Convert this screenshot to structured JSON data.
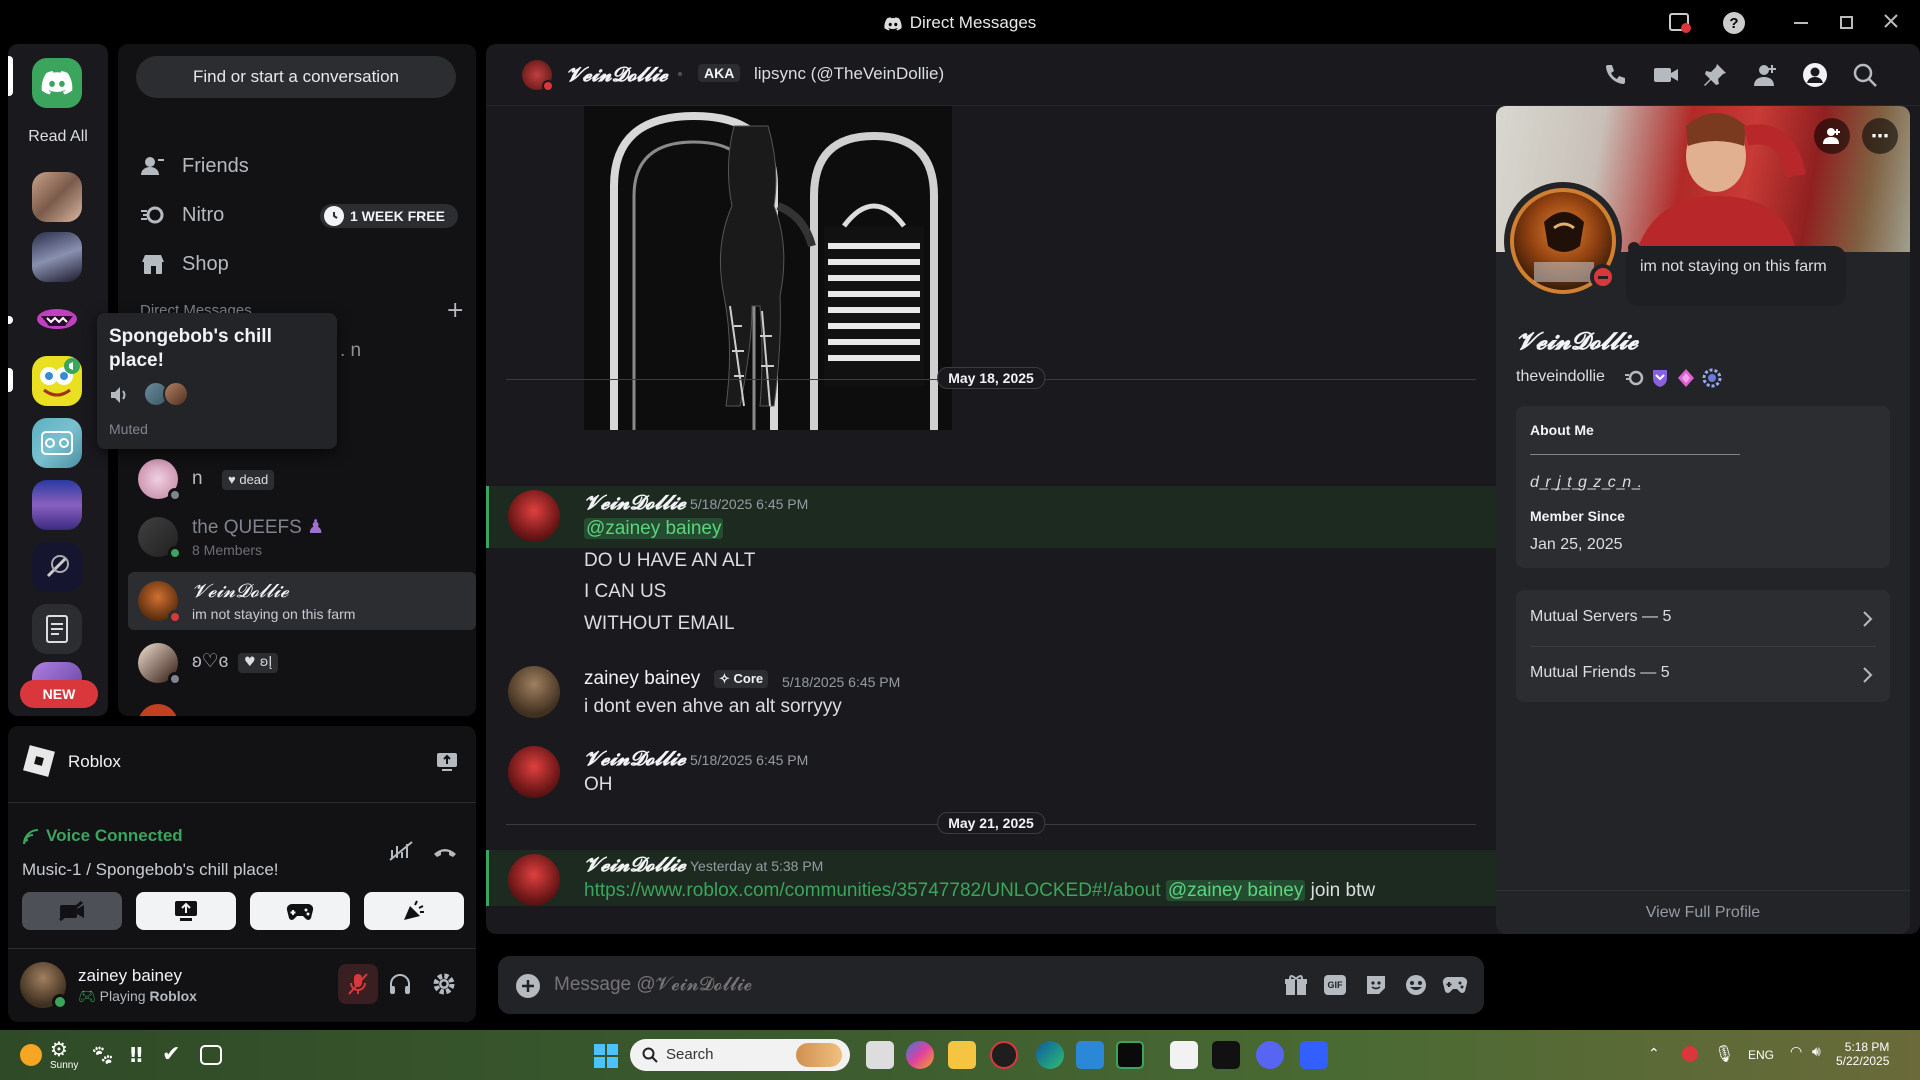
{
  "window": {
    "title": "Direct Messages"
  },
  "rail": {
    "read_all": "Read All",
    "new_badge": "NEW"
  },
  "tooltip": {
    "server_name": "Spongebob's chill place!",
    "status": "Muted"
  },
  "sidebar": {
    "find": "Find or start a conversation",
    "nav": [
      {
        "label": "Friends",
        "icon": "friends-icon"
      },
      {
        "label": "Nitro",
        "icon": "nitro-icon",
        "badge": "1 WEEK FREE"
      },
      {
        "label": "Shop",
        "icon": "shop-icon"
      }
    ],
    "dm_header": "Direct Messages",
    "dms": [
      {
        "name": "n",
        "tag": "dead"
      },
      {
        "name": "the QUEEFS",
        "sub": "8 Members"
      },
      {
        "name": "𝓥𝓮𝓲𝓷𝓓𝓸𝓵𝓵𝓲𝓮",
        "sub": "im not staying on this farm"
      },
      {
        "name": "ʚ♡ɞ",
        "tag": "ʚĮ"
      }
    ]
  },
  "activity": {
    "game": "Roblox"
  },
  "voice": {
    "status": "Voice Connected",
    "channel": "Music-1 / Spongebob's chill place!"
  },
  "user": {
    "name": "zainey bainey",
    "activity_prefix": "Playing",
    "activity_game": "Roblox"
  },
  "chat": {
    "header_name": "𝓥𝓮𝓲𝓷𝓓𝓸𝓵𝓵𝓲𝓮",
    "aka_label": "AKA",
    "aka_value": "lipsync (@TheVeinDollie)",
    "date1": "May 18, 2025",
    "date2": "May 21, 2025",
    "messages": [
      {
        "author": "𝓥𝓮𝓲𝓷𝓓𝓸𝓵𝓵𝓲𝓮",
        "ts": "5/18/2025 6:45 PM",
        "mention": "@zainey bainey",
        "lines": [
          "DO U HAVE AN ALT",
          "I CAN US",
          "WITHOUT EMAIL"
        ]
      },
      {
        "author": "zainey bainey",
        "tag": "Core",
        "ts": "5/18/2025 6:45 PM",
        "lines": [
          "i dont even ahve an alt sorryyy"
        ]
      },
      {
        "author": "𝓥𝓮𝓲𝓷𝓓𝓸𝓵𝓵𝓲𝓮",
        "ts": "5/18/2025 6:45 PM",
        "lines": [
          "OH"
        ]
      },
      {
        "author": "𝓥𝓮𝓲𝓷𝓓𝓸𝓵𝓵𝓲𝓮",
        "ts": "Yesterday at 5:38 PM",
        "link": "https://www.roblox.com/communities/35747782/UNLOCKED#!/about",
        "mention": "@zainey bainey",
        "suffix": "join btw"
      }
    ],
    "composer_placeholder": "Message @𝓥𝓮𝓲𝓷𝓓𝓸𝓵𝓵𝓲𝓮"
  },
  "profile": {
    "status_bubble": "im not staying on this farm",
    "display_name": "𝓥𝓮𝓲𝓷𝓓𝓸𝓵𝓵𝓲𝓮",
    "username": "theveindollie",
    "about_label": "About Me",
    "about_text": "d ͟r ͟j ͟t ͟g ͟z ͟c ͟n ͟.",
    "member_since_label": "Member Since",
    "member_since": "Jan 25, 2025",
    "mutual_servers": "Mutual Servers — 5",
    "mutual_friends": "Mutual Friends — 5",
    "view_full": "View Full Profile"
  },
  "taskbar": {
    "weather": "Sunny",
    "search": "Search",
    "lang": "ENG",
    "time": "5:18 PM",
    "date": "5/22/2025"
  },
  "colors": {
    "accent_green": "#3ba55d",
    "danger": "#da373c",
    "bg": "#1a1a1e"
  }
}
